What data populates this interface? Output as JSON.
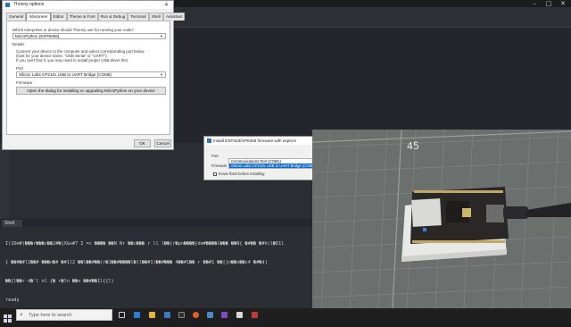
{
  "options_dialog": {
    "title": "Thonny options",
    "tabs": [
      "General",
      "Interpreter",
      "Editor",
      "Theme & Font",
      "Run & Debug",
      "Terminal",
      "Shell",
      "Assistant"
    ],
    "active_tab": "Interpreter",
    "question": "Which interpreter or device should Thonny use for running your code?",
    "interpreter_value": "MicroPython (ESP8266)",
    "details_label": "Details",
    "details_text": [
      "Connect your device to the computer and select corresponding port below",
      "(look for your device name, \"USB Serial\" or \"UART\").",
      "If you can't find it, you may need to install proper USB driver first."
    ],
    "port_label": "Port",
    "port_value": "Silicon Labs CP210x USB to UART Bridge (COM8)",
    "firmware_label": "Firmware",
    "firmware_button": "Open the dialog for installing or upgrading MicroPython on your device",
    "ok_button": "OK",
    "cancel_button": "Cancel"
  },
  "install_dialog": {
    "title": "Install ESP32/ESP8266 firmware with esptool",
    "port_label": "Port",
    "firmware_label": "Firmware",
    "port_options": [
      "Communications Port (COM1)",
      "Silicon Labs CP210x USB to UART Bridge (COM8)"
    ],
    "selected_index": 1,
    "erase_label": "Erase flash before installing"
  },
  "shell": {
    "tab_label": "Shell",
    "lines": [
      "I(1Dm#)���r���c��2#�{X&o#7 I =c  ���� ��N  Nr  ��c���  r ll l��{r�pn����}dm#����l��� ��N{ �#��  �#h(l�D1l",
      "  }  ��#�#l1��#  ���n�#  �#1l2      ��l��#��{r�1��#����l�{l��#1)��#���  4��#1��  r ��#1  ��[{n��n��c4  �#�d]",
      "  ��{l��r    d�'l  nl  {�  r�ln    ��n  ��#��1l{{l)",
      "ready"
    ]
  },
  "camera": {
    "ruler_number": "45"
  },
  "taskbar": {
    "search_placeholder": "Type here to search"
  }
}
